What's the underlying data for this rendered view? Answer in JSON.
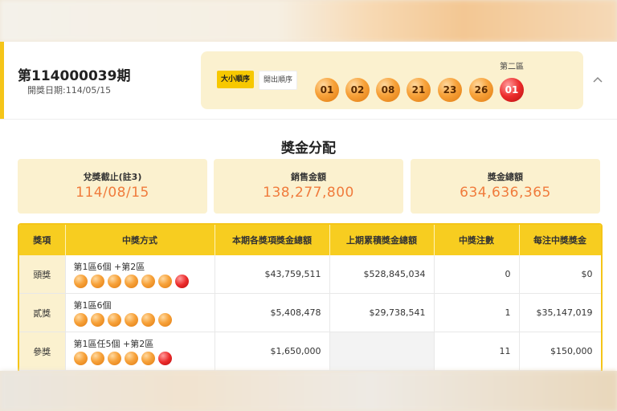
{
  "header": {
    "issue": "第114000039期",
    "draw_date": "開獎日期:114/05/15",
    "order_by_size": "大小順序",
    "order_by_draw": "開出順序",
    "zone2_label": "第二區",
    "balls": [
      "01",
      "02",
      "08",
      "21",
      "23",
      "26"
    ],
    "special_ball": "01"
  },
  "distribution": {
    "title": "獎金分配",
    "stats": [
      {
        "label": "兌獎截止(註3)",
        "value": "114/08/15"
      },
      {
        "label": "銷售金額",
        "value": "138,277,800"
      },
      {
        "label": "獎金總額",
        "value": "634,636,365"
      }
    ]
  },
  "table": {
    "headers": [
      "獎項",
      "中獎方式",
      "本期各獎項獎金總額",
      "上期累積獎金總額",
      "中獎注數",
      "每注中獎獎金"
    ],
    "rows": [
      {
        "prize": "頭獎",
        "method": "第1區6個 +第2區",
        "orange": 6,
        "red": 1,
        "current_total": "$43,759,511",
        "prev_accum": "$528,845,034",
        "winners": "0",
        "per_ticket": "$0"
      },
      {
        "prize": "貳獎",
        "method": "第1區6個",
        "orange": 6,
        "red": 0,
        "current_total": "$5,408,478",
        "prev_accum": "$29,738,541",
        "winners": "1",
        "per_ticket": "$35,147,019"
      },
      {
        "prize": "參獎",
        "method": "第1區任5個 +第2區",
        "orange": 5,
        "red": 1,
        "current_total": "$1,650,000",
        "prev_accum": "",
        "winners": "11",
        "per_ticket": "$150,000"
      }
    ]
  },
  "colors": {
    "accent": "#f5c518",
    "stat_value": "#f07b3c",
    "ball_orange": "#f7a23a",
    "ball_red": "#ec2b2b"
  },
  "icons": {
    "collapse": "chevron-up-icon"
  }
}
